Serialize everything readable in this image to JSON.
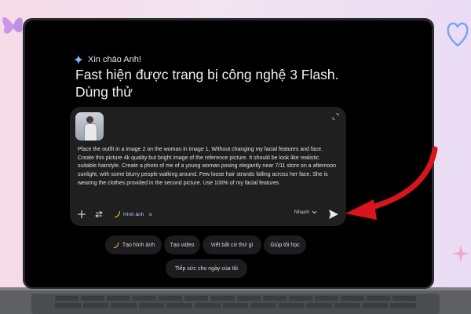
{
  "greeting": "Xin chào Anh!",
  "headline_line1": "Fast hiện được trang bị công nghệ 3 Flash.",
  "headline_line2": "Dùng thử",
  "prompt": {
    "text": "Place the outfit in a image 2 on the woman in image 1, Without changing my facial features and face. Create this picture 4k quality but bright image of the reference picture. It should be look like realistic. suitable hairstyle. Create a photo of me of a young woman posing elegantly near 7/11 store on a afternoon sunlight, with some blurry people walking around. Few loose hair strands falling across her face. She is wearing the clothes provided in the second picture. Use 100% of my facial features"
  },
  "toolbar": {
    "chip_label": "Hình ảnh",
    "chip_close": "×",
    "model_label": "Nhanh"
  },
  "suggestions": [
    "Tạo hình ảnh",
    "Tạo video",
    "Viết bất cứ thứ gì",
    "Giúp tôi học",
    "Tiếp sức cho ngày của tôi"
  ],
  "colors": {
    "accent_arrow": "#d9141c",
    "chip_text": "#a8c7fa",
    "sparkle": "#8ab4f8"
  },
  "icons": [
    "sparkle-icon",
    "expand-icon",
    "plus-icon",
    "tools-icon",
    "banana-icon",
    "chevron-down-icon",
    "send-icon"
  ]
}
